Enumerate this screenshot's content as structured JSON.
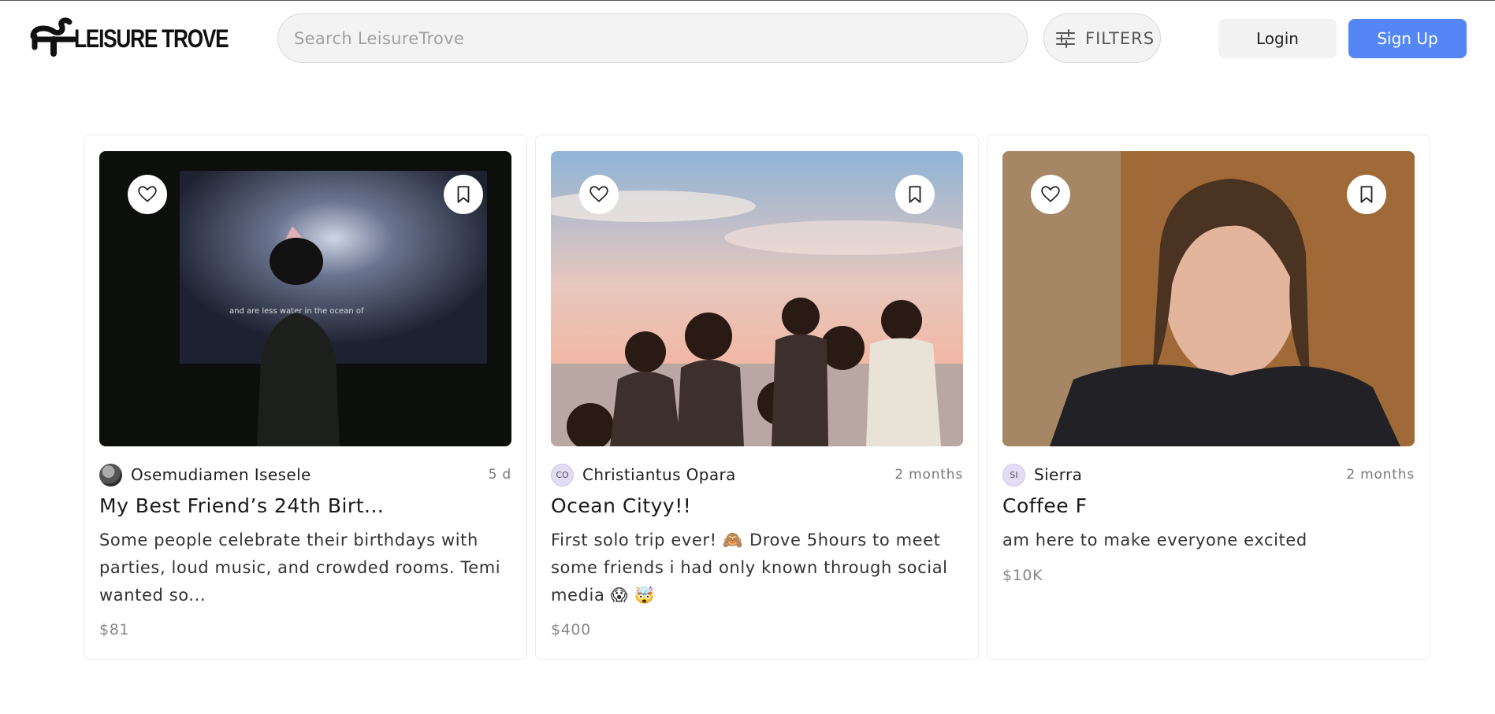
{
  "header": {
    "logo_text": "LEISURE TROVE",
    "search_placeholder": "Search LeisureTrove",
    "filters_label": "FILTERS",
    "login_label": "Login",
    "signup_label": "Sign Up",
    "accent_color": "#5487f5"
  },
  "cards": [
    {
      "author": "Osemudiamen Isesele",
      "author_initials": "",
      "time": "5 d",
      "title": "My Best Friend’s 24th Birt...",
      "description": "Some people celebrate their birthdays with parties, loud music, and crowded rooms. Temi wanted so...",
      "price": "$81",
      "image_caption_text": "and are less        water in the ocean of"
    },
    {
      "author": "Christiantus Opara",
      "author_initials": "CO",
      "time": "2 months",
      "title": "Ocean Cityy!!",
      "description": "First solo trip ever! 🙈 Drove 5hours to meet some friends i had only known through social media 😱 🤯",
      "price": "$400"
    },
    {
      "author": "Sierra",
      "author_initials": "SI",
      "time": "2 months",
      "title": "Coffee F",
      "description": "am here to make everyone excited",
      "price": "$10K"
    }
  ],
  "icons": {
    "like": "heart-icon",
    "save": "bookmark-icon",
    "filters": "sliders-icon"
  }
}
